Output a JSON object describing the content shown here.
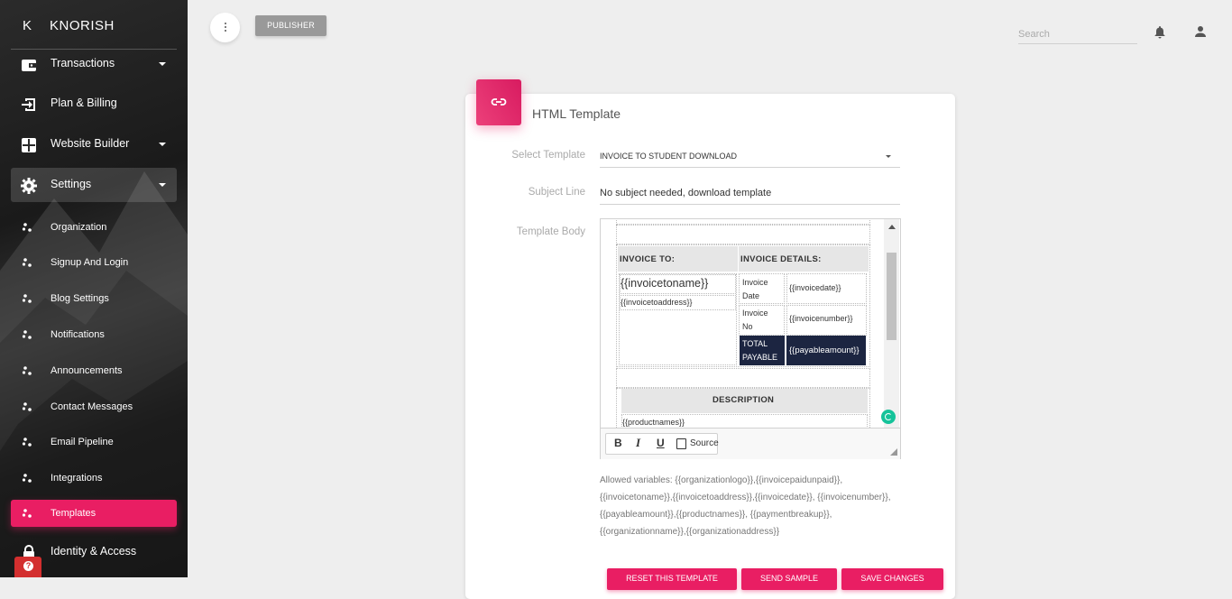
{
  "brand": {
    "mini": "K",
    "name": "KNORISH"
  },
  "nav": {
    "transactions": "Transactions",
    "plan_billing": "Plan & Billing",
    "website_builder": "Website Builder",
    "settings": "Settings",
    "identity_access": "Identity & Access"
  },
  "settings_items": [
    "Organization",
    "Signup And Login",
    "Blog Settings",
    "Notifications",
    "Announcements",
    "Contact Messages",
    "Email Pipeline",
    "Integrations",
    "Templates"
  ],
  "topbar": {
    "publisher_label": "PUBLISHER",
    "search_placeholder": "Search"
  },
  "card": {
    "title": "HTML Template",
    "select_template_label": "Select Template",
    "select_template_value": "INVOICE TO STUDENT DOWNLOAD",
    "subject_label": "Subject Line",
    "subject_value": "No subject needed, download template",
    "body_label": "Template Body"
  },
  "invoice_preview": {
    "invoice_to": "INVOICE TO:",
    "invoice_details": "INVOICE DETAILS:",
    "invoicetoname": "{{invoicetoname}}",
    "invoicetoaddress": "{{invoicetoaddress}}",
    "invoice_date_label": "Invoice Date",
    "invoice_date_value": "{{invoicedate}}",
    "invoice_no_label": "Invoice No",
    "invoice_no_value": "{{invoicenumber}}",
    "total_payable_label": "TOTAL PAYABLE",
    "total_payable_value": "{{payableamount}}",
    "description": "DESCRIPTION",
    "productnames": "{{productnames}}"
  },
  "toolbar": {
    "bold": "B",
    "italic": "I",
    "underline": "U",
    "source": "Source"
  },
  "allowed_variables": "Allowed variables: {{organizationlogo}},{{invoicepaidunpaid}}, {{invoicetoname}},{{invoicetoaddress}},{{invoicedate}}, {{invoicenumber}},{{payableamount}},{{productnames}}, {{paymentbreakup}},{{organizationname}},{{organizationaddress}}",
  "buttons": {
    "reset": "RESET THIS TEMPLATE",
    "send_sample": "SEND SAMPLE",
    "save": "SAVE CHANGES"
  },
  "colors": {
    "accent": "#e91e63",
    "navy": "#1c2541",
    "grammarly": "#15c39a"
  }
}
